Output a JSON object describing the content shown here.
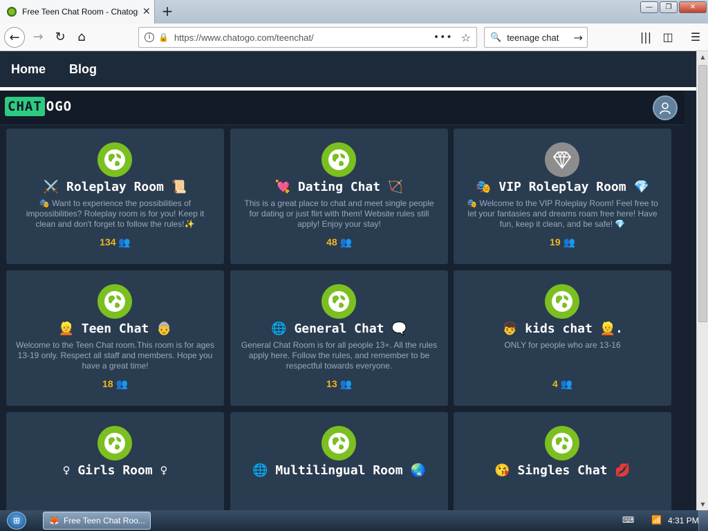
{
  "browser": {
    "tab_title": "Free Teen Chat Room - Chatogo",
    "tab_close": "✕",
    "new_tab": "+",
    "url": "https://www.chatogo.com/teenchat/",
    "url_dots": "•••",
    "search_text": "teenage chat",
    "window_buttons": [
      "—",
      "❐",
      "✕"
    ]
  },
  "site_nav": {
    "home": "Home",
    "blog": "Blog"
  },
  "logo": {
    "part1": "CHAT",
    "part2": "OGO"
  },
  "rooms": [
    {
      "title": "⚔️ Roleplay Room 📜",
      "desc": "🎭 Want to experience the possibilities of impossibilities? Roleplay room is for you! Keep it clean and don't forget to follow the rules!✨",
      "count": "134 👥",
      "icon": "globe-icon"
    },
    {
      "title": "💘 Dating Chat 🏹",
      "desc": "This is a great place to chat and meet single people for dating or just flirt with them! Website rules still apply! Enjoy your stay!",
      "count": "48 👥",
      "icon": "globe-icon"
    },
    {
      "title": "🎭 VIP Roleplay Room 💎",
      "desc": "🎭 Welcome to the VIP Roleplay Room! Feel free to let your fantasies and dreams roam free here! Have fun, keep it clean, and be safe! 💎",
      "count": "19 👥",
      "icon": "diamond-icon"
    },
    {
      "title": "👱 Teen Chat 👵",
      "desc": "Welcome to the Teen Chat room.This room is for ages 13-19 only. Respect all staff and members. Hope you have a great time!",
      "count": "18 👥",
      "icon": "globe-icon"
    },
    {
      "title": "🌐 General Chat 🗨️",
      "desc": "General Chat Room is for all people 13+. All the rules apply here. Follow the rules, and remember to be respectful towards everyone.",
      "count": "13 👥",
      "icon": "globe-icon"
    },
    {
      "title": "👦 kids chat 👱.",
      "desc": "ONLY for people who are 13-16",
      "count": "4 👥",
      "icon": "globe-icon"
    },
    {
      "title": "♀ Girls Room ♀",
      "desc": "",
      "count": "",
      "icon": "globe-icon"
    },
    {
      "title": "🌐 Multilingual Room 🌏",
      "desc": "",
      "count": "",
      "icon": "globe-icon"
    },
    {
      "title": "😘 Singles Chat 💋",
      "desc": "",
      "count": "",
      "icon": "globe-icon"
    }
  ],
  "taskbar": {
    "window_label": "Free Teen Chat Roo...",
    "clock": "4:31 PM"
  },
  "colors": {
    "page_bg": "#172130",
    "card_bg": "#2a3c50",
    "icon_green": "#7bbf21",
    "count_gold": "#f0b81c",
    "logo_green": "#2fca82"
  }
}
